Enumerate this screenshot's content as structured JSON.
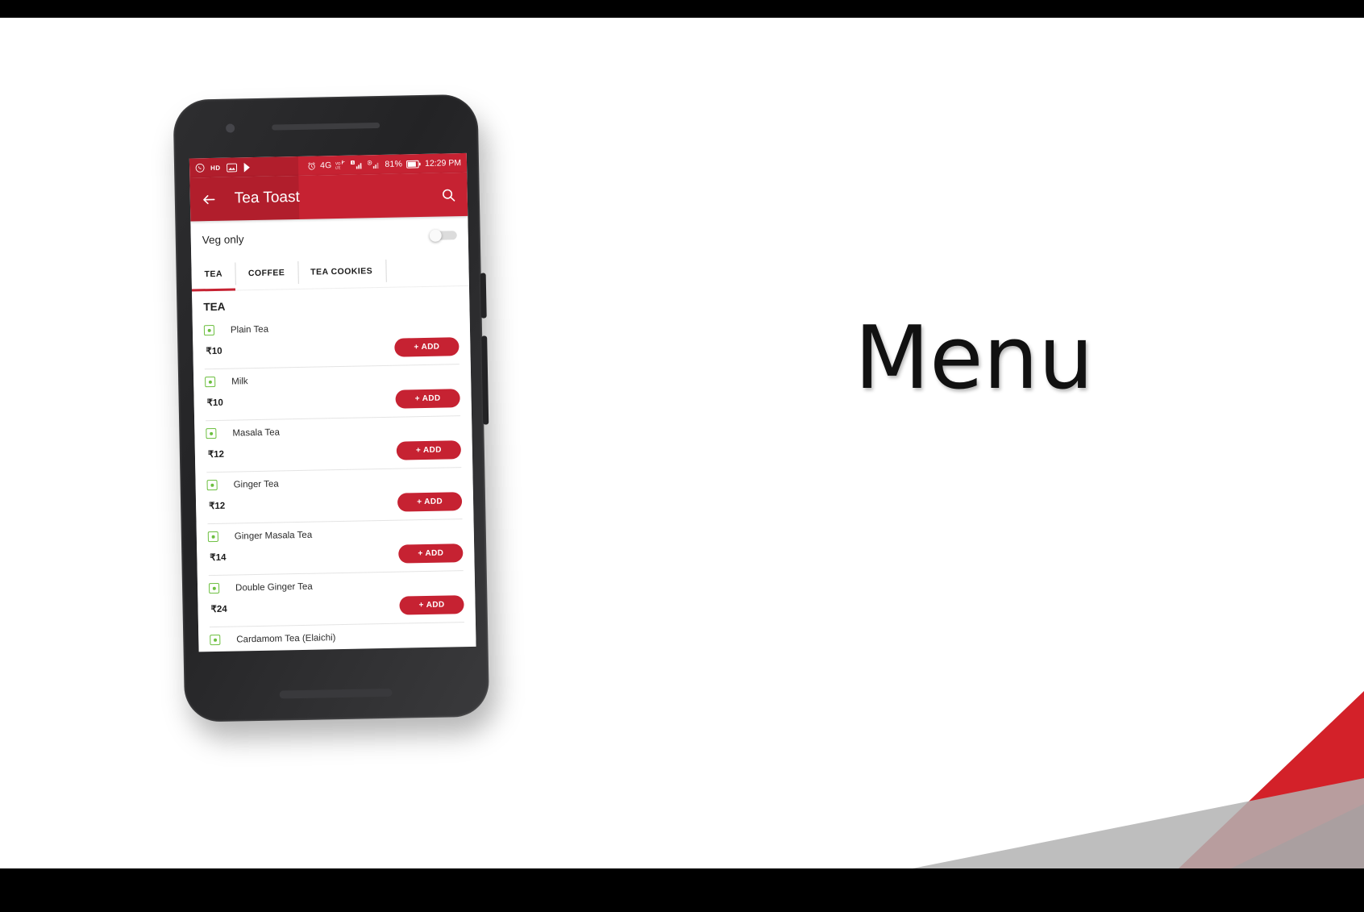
{
  "slide": {
    "headline": "Menu"
  },
  "phone": {
    "statusbar": {
      "left_icons": [
        "whatsapp-icon",
        "hd-icon",
        "photos-icon",
        "play-store-icon"
      ],
      "hd_label": "HD",
      "alarm_icon": "alarm-icon",
      "network_label": "4G",
      "volte_icon": "volte-icon",
      "sim1_signal_icon": "signal-bars-icon",
      "sim2_icon": "sim-alert-icon",
      "sim2_signal_icon": "signal-bars-icon",
      "battery_percent": "81%",
      "battery_icon": "battery-icon",
      "time": "12:29 PM"
    },
    "appbar": {
      "back_icon": "back-arrow-icon",
      "title": "Tea Toast",
      "search_icon": "search-icon"
    },
    "filter": {
      "veg_only_label": "Veg only",
      "veg_only_on": false
    },
    "tabs": [
      {
        "label": "TEA",
        "active": true
      },
      {
        "label": "COFFEE",
        "active": false
      },
      {
        "label": "TEA COOKIES",
        "active": false
      }
    ],
    "section_title": "TEA",
    "add_button_label": "+ ADD",
    "items": [
      {
        "name": "Plain Tea",
        "price": "₹10",
        "veg": true
      },
      {
        "name": "Milk",
        "price": "₹10",
        "veg": true
      },
      {
        "name": "Masala Tea",
        "price": "₹12",
        "veg": true
      },
      {
        "name": "Ginger Tea",
        "price": "₹12",
        "veg": true
      },
      {
        "name": "Ginger Masala Tea",
        "price": "₹14",
        "veg": true
      },
      {
        "name": "Double Ginger Tea",
        "price": "₹24",
        "veg": true
      },
      {
        "name": "Cardamom Tea (Elaichi)",
        "price": "",
        "veg": true
      }
    ]
  },
  "colors": {
    "brand_red": "#c62232",
    "veg_green": "#6cbf3f",
    "deco_red": "#d32129",
    "deco_gray": "#b3b3b3"
  }
}
